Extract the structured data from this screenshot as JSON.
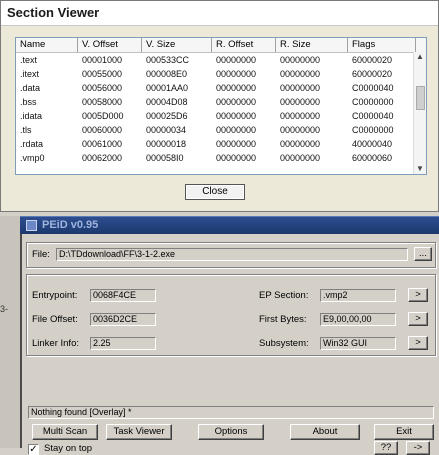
{
  "section_viewer": {
    "title": "Section Viewer",
    "columns": [
      "Name",
      "V. Offset",
      "V. Size",
      "R. Offset",
      "R. Size",
      "Flags"
    ],
    "rows": [
      [
        ".text",
        "00001000",
        "000533CC",
        "00000000",
        "00000000",
        "60000020"
      ],
      [
        ".itext",
        "00055000",
        "000008E0",
        "00000000",
        "00000000",
        "60000020"
      ],
      [
        ".data",
        "00056000",
        "00001AA0",
        "00000000",
        "00000000",
        "C0000040"
      ],
      [
        ".bss",
        "00058000",
        "00004D08",
        "00000000",
        "00000000",
        "C0000000"
      ],
      [
        ".idata",
        "0005D000",
        "000025D6",
        "00000000",
        "00000000",
        "C0000040"
      ],
      [
        ".tls",
        "00060000",
        "00000034",
        "00000000",
        "00000000",
        "C0000000"
      ],
      [
        ".rdata",
        "00061000",
        "00000018",
        "00000000",
        "00000000",
        "40000040"
      ],
      [
        ".vmp0",
        "00062000",
        "000058I0",
        "00000000",
        "00000000",
        "60000060"
      ]
    ],
    "close_label": "Close"
  },
  "peid": {
    "title": "PEiD v0.95",
    "file_label": "File:",
    "file_value": "D:\\TDdownload\\FF\\3-1-2.exe",
    "browse_label": "...",
    "entrypoint_label": "Entrypoint:",
    "entrypoint_value": "0068F4CE",
    "file_offset_label": "File Offset:",
    "file_offset_value": "0036D2CE",
    "linker_info_label": "Linker Info:",
    "linker_info_value": "2.25",
    "ep_section_label": "EP Section:",
    "ep_section_value": ".vmp2",
    "first_bytes_label": "First Bytes:",
    "first_bytes_value": "E9,00,00,00",
    "subsystem_label": "Subsystem:",
    "subsystem_value": "Win32 GUI",
    "arrow_label": ">",
    "result": "Nothing found [Overlay] *",
    "buttons": [
      "Multi Scan",
      "Task Viewer",
      "Options",
      "About",
      "Exit"
    ],
    "stay_on_top_label": "Stay on top",
    "stay_on_top_checked": true,
    "help_label": "??",
    "more_label": "->"
  }
}
